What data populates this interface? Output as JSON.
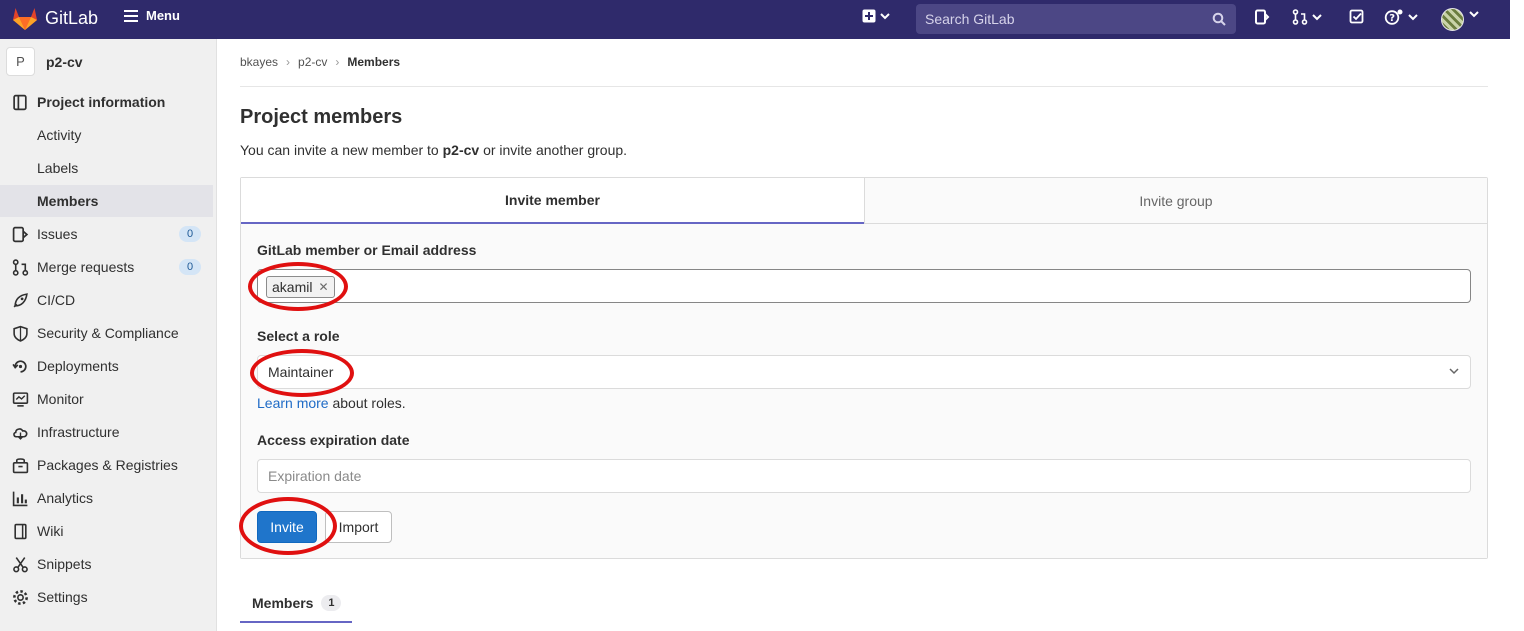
{
  "topbar": {
    "logo_text": "GitLab",
    "menu_label": "Menu",
    "search_placeholder": "Search GitLab",
    "icons": [
      "plus-icon",
      "search-icon",
      "issues-icon",
      "merge-request-icon",
      "todo-icon",
      "help-icon",
      "avatar"
    ]
  },
  "sidebar": {
    "project_initial": "P",
    "project_name": "p2-cv",
    "items": [
      {
        "label": "Project information",
        "icon": "info-icon"
      },
      {
        "label": "Activity"
      },
      {
        "label": "Labels"
      },
      {
        "label": "Members"
      },
      {
        "label": "Issues",
        "icon": "issues-icon",
        "count": "0"
      },
      {
        "label": "Merge requests",
        "icon": "merge-request-icon",
        "count": "0"
      },
      {
        "label": "CI/CD",
        "icon": "rocket-icon"
      },
      {
        "label": "Security & Compliance",
        "icon": "shield-icon"
      },
      {
        "label": "Deployments",
        "icon": "deployments-icon"
      },
      {
        "label": "Monitor",
        "icon": "monitor-icon"
      },
      {
        "label": "Infrastructure",
        "icon": "cloud-icon"
      },
      {
        "label": "Packages & Registries",
        "icon": "package-icon"
      },
      {
        "label": "Analytics",
        "icon": "chart-icon"
      },
      {
        "label": "Wiki",
        "icon": "book-icon"
      },
      {
        "label": "Snippets",
        "icon": "scissors-icon"
      },
      {
        "label": "Settings",
        "icon": "gear-icon"
      }
    ]
  },
  "breadcrumb": {
    "items": [
      "bkayes",
      "p2-cv",
      "Members"
    ]
  },
  "page": {
    "title": "Project members",
    "intro_prefix": "You can invite a new member to ",
    "intro_project": "p2-cv",
    "intro_suffix": " or invite another group."
  },
  "invite": {
    "tabs": [
      "Invite member",
      "Invite group"
    ],
    "member_label": "GitLab member or Email address",
    "token": "akamil",
    "role_label": "Select a role",
    "role_value": "Maintainer",
    "learn_more": "Learn more",
    "learn_more_suffix": " about roles.",
    "expiration_label": "Access expiration date",
    "expiration_placeholder": "Expiration date",
    "invite_button": "Invite",
    "import_button": "Import"
  },
  "members_tab": {
    "label": "Members",
    "count": "1"
  },
  "colors": {
    "topbar": "#2f2a6b",
    "primary": "#1f75cb",
    "annotation": "#e01010"
  }
}
